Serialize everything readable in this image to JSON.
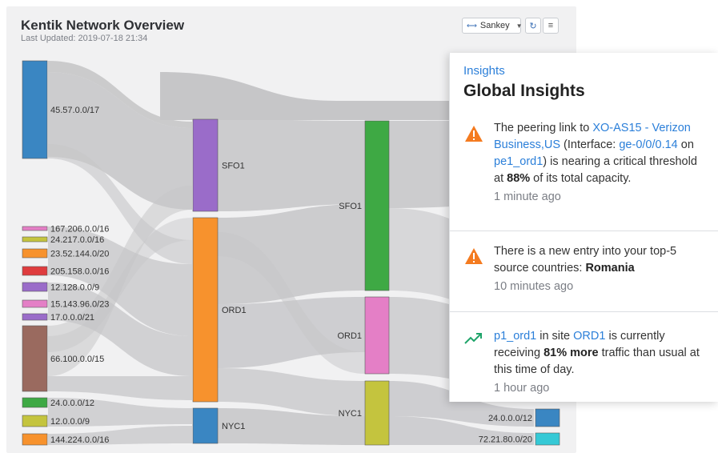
{
  "header": {
    "title": "Kentik Network Overview",
    "last_updated": "Last Updated: 2019-07-18 21:34"
  },
  "toolbar": {
    "view_select": "Sankey",
    "refresh_icon": "refresh-icon",
    "menu_icon": "menu-icon"
  },
  "sankey": {
    "sources": [
      {
        "label": "45.57.0.0/17",
        "color": "#3a86c2"
      },
      {
        "label": "167.206.0.0/16",
        "color": "#e47fc6"
      },
      {
        "label": "24.217.0.0/16",
        "color": "#c4c43e"
      },
      {
        "label": "23.52.144.0/20",
        "color": "#f7922d"
      },
      {
        "label": "205.158.0.0/16",
        "color": "#df3c3e"
      },
      {
        "label": "12.128.0.0/9",
        "color": "#9a6cc9"
      },
      {
        "label": "15.143.96.0/23",
        "color": "#e47fc6"
      },
      {
        "label": "17.0.0.0/21",
        "color": "#9a6cc9"
      },
      {
        "label": "66.100.0.0/15",
        "color": "#9a6a5f"
      },
      {
        "label": "24.0.0.0/12",
        "color": "#3ea944"
      },
      {
        "label": "12.0.0.0/9",
        "color": "#c4c43e"
      },
      {
        "label": "144.224.0.0/16",
        "color": "#f7922d"
      }
    ],
    "sites": [
      {
        "label": "SFO1",
        "color": "#9a6cc9"
      },
      {
        "label": "ORD1",
        "color": "#f7922d"
      },
      {
        "label": "NYC1",
        "color": "#3a86c2"
      }
    ],
    "sites2": [
      {
        "label": "SFO1",
        "color": "#3ea944"
      },
      {
        "label": "ORD1",
        "color": "#e47fc6"
      },
      {
        "label": "NYC1",
        "color": "#c4c43e"
      }
    ],
    "destinations": [
      {
        "label": "24.0.0.0/12",
        "color": "#3a86c2"
      },
      {
        "label": "72.21.80.0/20",
        "color": "#35c9d6"
      }
    ]
  },
  "insights": {
    "kicker": "Insights",
    "title": "Global Insights",
    "items": [
      {
        "icon": "warning-icon",
        "p1": "The peering link to ",
        "link1": "XO-AS15 - Verizon Business,US",
        "p2": " (Interface: ",
        "link2": "ge-0/0/0.14",
        "p3": " on ",
        "link3": "pe1_ord1",
        "p4": ") is nearing a critical threshold at ",
        "bold1": "88%",
        "p5": " of its total capacity.",
        "time": "1 minute ago"
      },
      {
        "icon": "warning-icon",
        "p1": "There is a new entry into your top-5 source countries: ",
        "bold1": "Romania",
        "time": "10 minutes ago"
      },
      {
        "icon": "trending-up-icon",
        "link1": "p1_ord1",
        "p1": " in site ",
        "link2": "ORD1",
        "p2": " is currently receiving ",
        "bold1": "81% more",
        "p3": " traffic than usual at this time of day.",
        "time": "1 hour ago"
      }
    ]
  },
  "colors": {
    "link_blue": "#2b7fd9",
    "warning": "#f47b20",
    "trend": "#1fa46a",
    "flow": "#c6c6c8"
  }
}
